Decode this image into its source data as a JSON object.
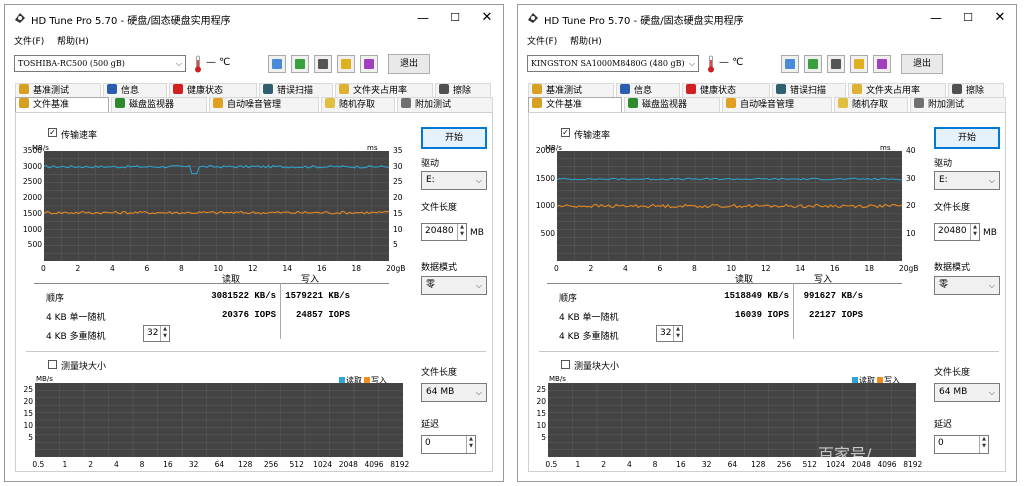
{
  "colors": {
    "read_line": "#2aa7d6",
    "write_line": "#f08c1e",
    "chart_bg": "#444444",
    "grid": "#5a5a5a",
    "start_border": "#0078d7"
  },
  "windows": [
    {
      "title": "HD Tune Pro 5.70 - 硬盘/固态硬盘实用程序",
      "menu": {
        "file": "文件(F)",
        "help": "帮助(H)"
      },
      "drive": "TOSHIBA-RC500 (500 gB)",
      "temp": "— ℃",
      "exit": "退出",
      "tabs_row1": [
        "基准测试",
        "信息",
        "健康状态",
        "错误扫描",
        "文件夹占用率",
        "擦除"
      ],
      "tabs_row2": [
        "文件基准",
        "磁盘监视器",
        "自动噪音管理",
        "随机存取",
        "附加测试"
      ],
      "transfer_label": "传输速率",
      "start": "开始",
      "drive_label": "驱动",
      "drive_value": "E:",
      "filelen_label": "文件长度",
      "filelen_value": "20480",
      "filelen_unit": "MB",
      "datamode_label": "数据模式",
      "datamode_value": "零",
      "read_hdr": "读取",
      "write_hdr": "写入",
      "rows": [
        {
          "label": "顺序",
          "read": "3081522 KB/s",
          "write": "1579221 KB/s"
        },
        {
          "label": "4 KB 单一随机",
          "read": "20376 IOPS",
          "write": "24857 IOPS"
        },
        {
          "label": "4 KB 多重随机",
          "qd": "32"
        }
      ],
      "blocksize_label": "测量块大小",
      "filelen2_label": "文件长度",
      "filelen2_value": "64 MB",
      "delay_label": "延迟",
      "delay_value": "0",
      "legend_read": "读取",
      "legend_write": "写入",
      "chart_data": {
        "type": "line",
        "x_label": "gB",
        "x_ticks": [
          "0",
          "2",
          "4",
          "6",
          "8",
          "10",
          "12",
          "14",
          "16",
          "18",
          "20gB"
        ],
        "y_left_unit": "MB/s",
        "y_left_ticks": [
          "3500",
          "3000",
          "2500",
          "2000",
          "1500",
          "1000",
          "500"
        ],
        "y_left_max": 3500,
        "y_right_unit": "ms",
        "y_right_ticks": [
          "35",
          "30",
          "25",
          "20",
          "15",
          "10",
          "5"
        ],
        "series": [
          {
            "name": "读取",
            "mean": 3000,
            "jitter": 40,
            "dips": [
              [
                8.7,
                2780
              ]
            ]
          },
          {
            "name": "写入",
            "mean": 1540,
            "jitter": 45,
            "dips": []
          }
        ]
      },
      "chart2": {
        "y_unit": "MB/s",
        "y_ticks": [
          "25",
          "20",
          "15",
          "10",
          "5"
        ],
        "x_ticks": [
          "0.5",
          "1",
          "2",
          "4",
          "8",
          "16",
          "32",
          "64",
          "128",
          "256",
          "512",
          "1024",
          "2048",
          "4096",
          "8192"
        ]
      }
    },
    {
      "title": "HD Tune Pro 5.70 - 硬盘/固态硬盘实用程序",
      "menu": {
        "file": "文件(F)",
        "help": "帮助(H)"
      },
      "drive": "KINGSTON SA1000M8480G (480 gB)",
      "temp": "— ℃",
      "exit": "退出",
      "tabs_row1": [
        "基准测试",
        "信息",
        "健康状态",
        "错误扫描",
        "文件夹占用率",
        "擦除"
      ],
      "tabs_row2": [
        "文件基准",
        "磁盘监视器",
        "自动噪音管理",
        "随机存取",
        "附加测试"
      ],
      "transfer_label": "传输速率",
      "start": "开始",
      "drive_label": "驱动",
      "drive_value": "E:",
      "filelen_label": "文件长度",
      "filelen_value": "20480",
      "filelen_unit": "MB",
      "datamode_label": "数据模式",
      "datamode_value": "零",
      "read_hdr": "读取",
      "write_hdr": "写入",
      "rows": [
        {
          "label": "顺序",
          "read": "1518849 KB/s",
          "write": "991627 KB/s"
        },
        {
          "label": "4 KB 单一随机",
          "read": "16039 IOPS",
          "write": "22127 IOPS"
        },
        {
          "label": "4 KB 多重随机",
          "qd": "32"
        }
      ],
      "blocksize_label": "测量块大小",
      "filelen2_label": "文件长度",
      "filelen2_value": "64 MB",
      "delay_label": "延迟",
      "delay_value": "0",
      "legend_read": "读取",
      "legend_write": "写入",
      "chart_data": {
        "type": "line",
        "x_label": "gB",
        "x_ticks": [
          "0",
          "2",
          "4",
          "6",
          "8",
          "10",
          "12",
          "14",
          "16",
          "18",
          "20gB"
        ],
        "y_left_unit": "MB/s",
        "y_left_ticks": [
          "2000",
          "1500",
          "1000",
          "500"
        ],
        "y_left_max": 2000,
        "y_right_unit": "ms",
        "y_right_ticks": [
          "40",
          "30",
          "20",
          "10"
        ],
        "series": [
          {
            "name": "读取",
            "mean": 1490,
            "jitter": 15,
            "dips": []
          },
          {
            "name": "写入",
            "mean": 1000,
            "jitter": 30,
            "dips": []
          }
        ]
      },
      "chart2": {
        "y_unit": "MB/s",
        "y_ticks": [
          "25",
          "20",
          "15",
          "10",
          "5"
        ],
        "x_ticks": [
          "0.5",
          "1",
          "2",
          "4",
          "8",
          "16",
          "32",
          "64",
          "128",
          "256",
          "512",
          "1024",
          "2048",
          "4096",
          "8192"
        ]
      }
    }
  ],
  "watermark": "百家号/"
}
